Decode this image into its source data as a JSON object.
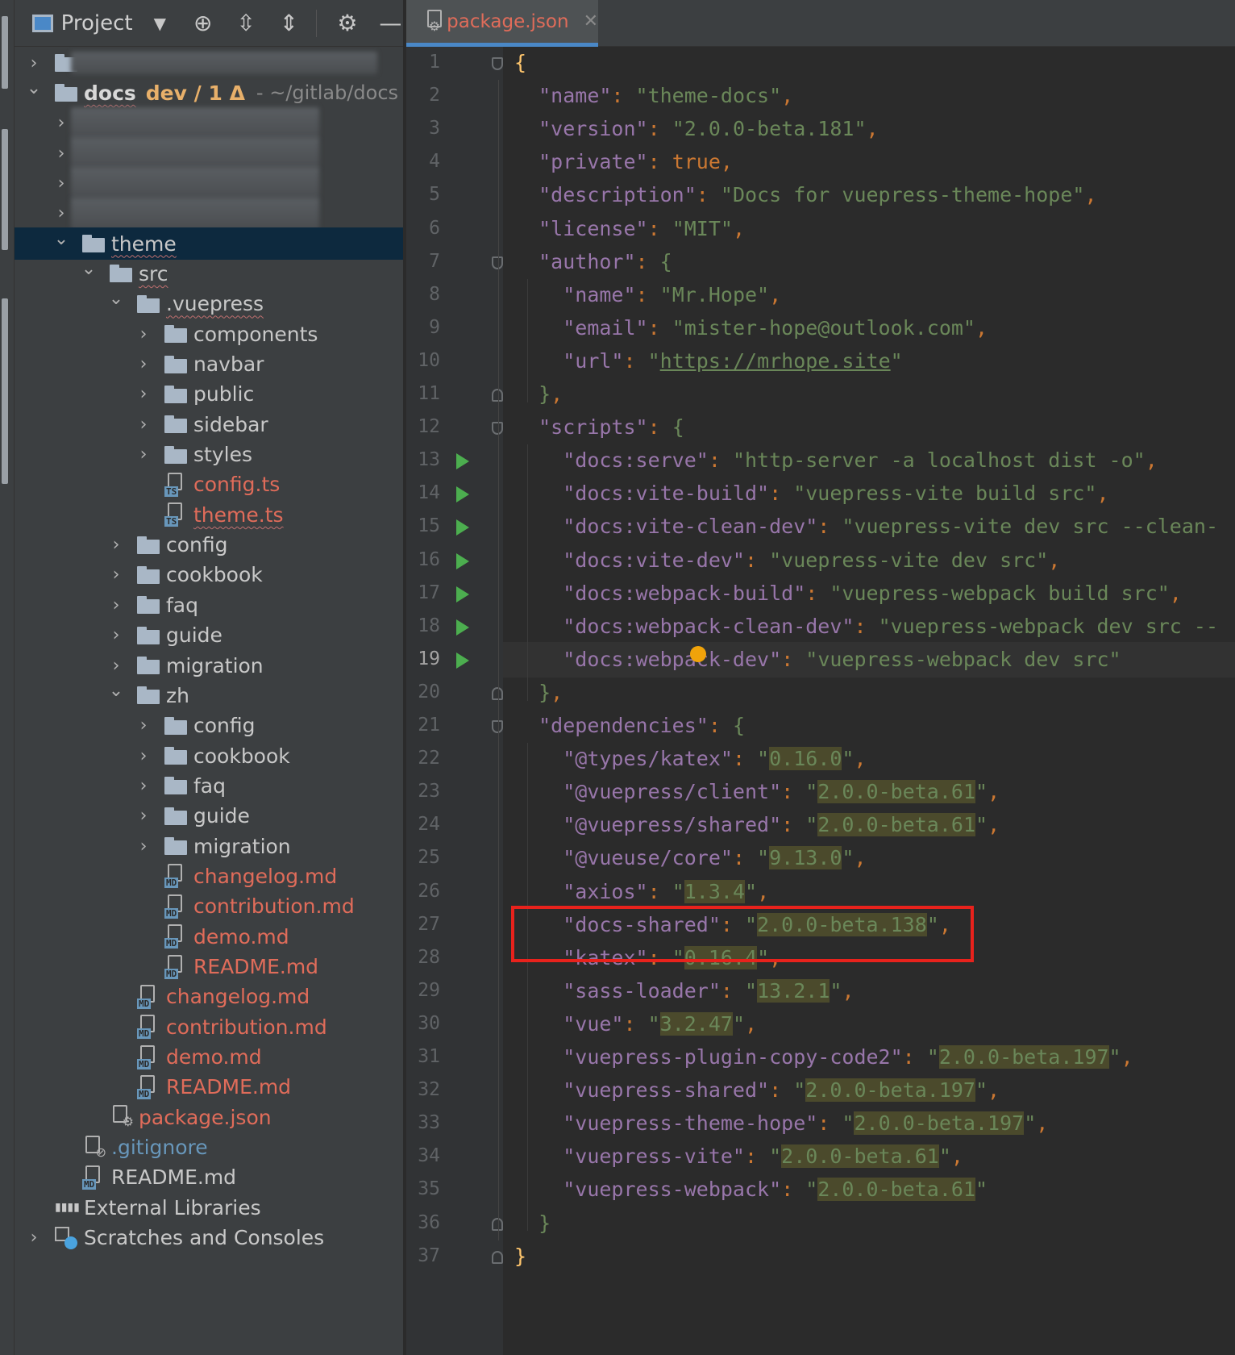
{
  "project_panel": {
    "title": "Project",
    "toolbar_icons": [
      "locate-icon",
      "expand-all-icon",
      "collapse-all-icon",
      "gear-icon",
      "hide-icon"
    ]
  },
  "tree": [
    {
      "depth": 0,
      "arrow": "right",
      "icon": "folder",
      "label": "",
      "style": "blur"
    },
    {
      "depth": 0,
      "arrow": "down",
      "icon": "folder",
      "label": "docs",
      "branch": "dev / 1 Δ",
      "path": "- ~/gitlab/docs",
      "style": "bold"
    },
    {
      "depth": 1,
      "arrow": "right",
      "icon": "none",
      "label": "",
      "style": "blur"
    },
    {
      "depth": 1,
      "arrow": "right",
      "icon": "none",
      "label": "",
      "style": "blur"
    },
    {
      "depth": 1,
      "arrow": "right",
      "icon": "none",
      "label": "",
      "style": "blur"
    },
    {
      "depth": 1,
      "arrow": "right",
      "icon": "none",
      "label": "",
      "style": "blur"
    },
    {
      "depth": 1,
      "arrow": "down",
      "icon": "folder",
      "label": "theme",
      "style": "squiggle",
      "selected": true
    },
    {
      "depth": 2,
      "arrow": "down",
      "icon": "folder",
      "label": "src",
      "style": "squiggle"
    },
    {
      "depth": 3,
      "arrow": "down",
      "icon": "folder",
      "label": ".vuepress",
      "style": "squiggle"
    },
    {
      "depth": 4,
      "arrow": "right",
      "icon": "folder",
      "label": "components"
    },
    {
      "depth": 4,
      "arrow": "right",
      "icon": "folder",
      "label": "navbar"
    },
    {
      "depth": 4,
      "arrow": "right",
      "icon": "folder",
      "label": "public"
    },
    {
      "depth": 4,
      "arrow": "right",
      "icon": "folder",
      "label": "sidebar"
    },
    {
      "depth": 4,
      "arrow": "right",
      "icon": "folder",
      "label": "styles"
    },
    {
      "depth": 4,
      "arrow": "none",
      "icon": "ts",
      "label": "config.ts",
      "style": "red"
    },
    {
      "depth": 4,
      "arrow": "none",
      "icon": "ts",
      "label": "theme.ts",
      "style": "red-squiggle"
    },
    {
      "depth": 3,
      "arrow": "right",
      "icon": "folder",
      "label": "config"
    },
    {
      "depth": 3,
      "arrow": "right",
      "icon": "folder",
      "label": "cookbook"
    },
    {
      "depth": 3,
      "arrow": "right",
      "icon": "folder",
      "label": "faq"
    },
    {
      "depth": 3,
      "arrow": "right",
      "icon": "folder",
      "label": "guide"
    },
    {
      "depth": 3,
      "arrow": "right",
      "icon": "folder",
      "label": "migration"
    },
    {
      "depth": 3,
      "arrow": "down",
      "icon": "folder",
      "label": "zh"
    },
    {
      "depth": 4,
      "arrow": "right",
      "icon": "folder",
      "label": "config"
    },
    {
      "depth": 4,
      "arrow": "right",
      "icon": "folder",
      "label": "cookbook"
    },
    {
      "depth": 4,
      "arrow": "right",
      "icon": "folder",
      "label": "faq"
    },
    {
      "depth": 4,
      "arrow": "right",
      "icon": "folder",
      "label": "guide"
    },
    {
      "depth": 4,
      "arrow": "right",
      "icon": "folder",
      "label": "migration"
    },
    {
      "depth": 4,
      "arrow": "none",
      "icon": "md",
      "label": "changelog.md",
      "style": "red"
    },
    {
      "depth": 4,
      "arrow": "none",
      "icon": "md",
      "label": "contribution.md",
      "style": "red"
    },
    {
      "depth": 4,
      "arrow": "none",
      "icon": "md",
      "label": "demo.md",
      "style": "red"
    },
    {
      "depth": 4,
      "arrow": "none",
      "icon": "md",
      "label": "README.md",
      "style": "red"
    },
    {
      "depth": 3,
      "arrow": "none",
      "icon": "md",
      "label": "changelog.md",
      "style": "red"
    },
    {
      "depth": 3,
      "arrow": "none",
      "icon": "md",
      "label": "contribution.md",
      "style": "red"
    },
    {
      "depth": 3,
      "arrow": "none",
      "icon": "md",
      "label": "demo.md",
      "style": "red"
    },
    {
      "depth": 3,
      "arrow": "none",
      "icon": "md",
      "label": "README.md",
      "style": "red"
    },
    {
      "depth": 2,
      "arrow": "none",
      "icon": "json",
      "label": "package.json",
      "style": "red"
    },
    {
      "depth": 1,
      "arrow": "none",
      "icon": "git",
      "label": ".gitignore",
      "style": "blue"
    },
    {
      "depth": 1,
      "arrow": "none",
      "icon": "md",
      "label": "README.md"
    },
    {
      "depth": 0,
      "arrow": "none",
      "icon": "lib",
      "label": "External Libraries"
    },
    {
      "depth": 0,
      "arrow": "right",
      "icon": "scratch",
      "label": "Scratches and Consoles"
    }
  ],
  "editor": {
    "tab_label": "package.json",
    "current_line": 19,
    "run_lines": [
      13,
      14,
      15,
      16,
      17,
      18,
      19
    ],
    "fold_open_lines": [
      1,
      7,
      12,
      21
    ],
    "fold_close_lines": [
      11,
      20,
      36,
      37
    ],
    "highlight_line": 27,
    "lines": [
      [
        {
          "t": "{",
          "c": "b"
        }
      ],
      [
        {
          "t": "  "
        },
        {
          "t": "\"name\"",
          "c": "k"
        },
        {
          "t": ": ",
          "c": "p"
        },
        {
          "t": "\"theme-docs\"",
          "c": "s"
        },
        {
          "t": ",",
          "c": "p"
        }
      ],
      [
        {
          "t": "  "
        },
        {
          "t": "\"version\"",
          "c": "k"
        },
        {
          "t": ": ",
          "c": "p"
        },
        {
          "t": "\"2.0.0-beta.181\"",
          "c": "s"
        },
        {
          "t": ",",
          "c": "p"
        }
      ],
      [
        {
          "t": "  "
        },
        {
          "t": "\"private\"",
          "c": "k"
        },
        {
          "t": ": ",
          "c": "p"
        },
        {
          "t": "true",
          "c": "kw"
        },
        {
          "t": ",",
          "c": "p"
        }
      ],
      [
        {
          "t": "  "
        },
        {
          "t": "\"description\"",
          "c": "k"
        },
        {
          "t": ": ",
          "c": "p"
        },
        {
          "t": "\"Docs for vuepress-theme-hope\"",
          "c": "s"
        },
        {
          "t": ",",
          "c": "p"
        }
      ],
      [
        {
          "t": "  "
        },
        {
          "t": "\"license\"",
          "c": "k"
        },
        {
          "t": ": ",
          "c": "p"
        },
        {
          "t": "\"MIT\"",
          "c": "s"
        },
        {
          "t": ",",
          "c": "p"
        }
      ],
      [
        {
          "t": "  "
        },
        {
          "t": "\"author\"",
          "c": "k"
        },
        {
          "t": ": ",
          "c": "p"
        },
        {
          "t": "{",
          "c": "bg"
        }
      ],
      [
        {
          "t": "    "
        },
        {
          "t": "\"name\"",
          "c": "k"
        },
        {
          "t": ": ",
          "c": "p"
        },
        {
          "t": "\"Mr.Hope\"",
          "c": "s"
        },
        {
          "t": ",",
          "c": "p"
        }
      ],
      [
        {
          "t": "    "
        },
        {
          "t": "\"email\"",
          "c": "k"
        },
        {
          "t": ": ",
          "c": "p"
        },
        {
          "t": "\"mister-hope@outlook.com\"",
          "c": "s"
        },
        {
          "t": ",",
          "c": "p"
        }
      ],
      [
        {
          "t": "    "
        },
        {
          "t": "\"url\"",
          "c": "k"
        },
        {
          "t": ": ",
          "c": "p"
        },
        {
          "t": "\"",
          "c": "s"
        },
        {
          "t": "https://mrhope.site",
          "c": "url"
        },
        {
          "t": "\"",
          "c": "s"
        }
      ],
      [
        {
          "t": "  "
        },
        {
          "t": "}",
          "c": "bg"
        },
        {
          "t": ",",
          "c": "p"
        }
      ],
      [
        {
          "t": "  "
        },
        {
          "t": "\"scripts\"",
          "c": "k"
        },
        {
          "t": ": ",
          "c": "p"
        },
        {
          "t": "{",
          "c": "bg"
        }
      ],
      [
        {
          "t": "    "
        },
        {
          "t": "\"docs:serve\"",
          "c": "k"
        },
        {
          "t": ": ",
          "c": "p"
        },
        {
          "t": "\"http-server -a localhost dist -o\"",
          "c": "s"
        },
        {
          "t": ",",
          "c": "p"
        }
      ],
      [
        {
          "t": "    "
        },
        {
          "t": "\"docs:vite-build\"",
          "c": "k"
        },
        {
          "t": ": ",
          "c": "p"
        },
        {
          "t": "\"vuepress-vite build src\"",
          "c": "s"
        },
        {
          "t": ",",
          "c": "p"
        }
      ],
      [
        {
          "t": "    "
        },
        {
          "t": "\"docs:vite-clean-dev\"",
          "c": "k"
        },
        {
          "t": ": ",
          "c": "p"
        },
        {
          "t": "\"vuepress-vite dev src --clean-",
          "c": "s"
        }
      ],
      [
        {
          "t": "    "
        },
        {
          "t": "\"docs:vite-dev\"",
          "c": "k"
        },
        {
          "t": ": ",
          "c": "p"
        },
        {
          "t": "\"vuepress-vite dev src\"",
          "c": "s"
        },
        {
          "t": ",",
          "c": "p"
        }
      ],
      [
        {
          "t": "    "
        },
        {
          "t": "\"docs:webpack-build\"",
          "c": "k"
        },
        {
          "t": ": ",
          "c": "p"
        },
        {
          "t": "\"vuepress-webpack build src\"",
          "c": "s"
        },
        {
          "t": ",",
          "c": "p"
        }
      ],
      [
        {
          "t": "    "
        },
        {
          "t": "\"docs:webpack-clean-dev\"",
          "c": "k"
        },
        {
          "t": ": ",
          "c": "p"
        },
        {
          "t": "\"vuepress-webpack dev src --",
          "c": "s"
        }
      ],
      [
        {
          "t": "    "
        },
        {
          "t": "\"docs:webpack-dev\"",
          "c": "k"
        },
        {
          "t": ": ",
          "c": "p"
        },
        {
          "t": "\"vuepress-webpack dev src\"",
          "c": "s"
        }
      ],
      [
        {
          "t": "  "
        },
        {
          "t": "}",
          "c": "bg"
        },
        {
          "t": ",",
          "c": "p"
        }
      ],
      [
        {
          "t": "  "
        },
        {
          "t": "\"dependencies\"",
          "c": "k"
        },
        {
          "t": ": ",
          "c": "p"
        },
        {
          "t": "{",
          "c": "bg"
        }
      ],
      [
        {
          "t": "    "
        },
        {
          "t": "\"@types/katex\"",
          "c": "k"
        },
        {
          "t": ": ",
          "c": "p"
        },
        {
          "t": "\"",
          "c": "s"
        },
        {
          "t": "0.16.0",
          "c": "hl"
        },
        {
          "t": "\"",
          "c": "s"
        },
        {
          "t": ",",
          "c": "p"
        }
      ],
      [
        {
          "t": "    "
        },
        {
          "t": "\"@vuepress/client\"",
          "c": "k"
        },
        {
          "t": ": ",
          "c": "p"
        },
        {
          "t": "\"",
          "c": "s"
        },
        {
          "t": "2.0.0-beta.61",
          "c": "hl"
        },
        {
          "t": "\"",
          "c": "s"
        },
        {
          "t": ",",
          "c": "p"
        }
      ],
      [
        {
          "t": "    "
        },
        {
          "t": "\"@vuepress/shared\"",
          "c": "k"
        },
        {
          "t": ": ",
          "c": "p"
        },
        {
          "t": "\"",
          "c": "s"
        },
        {
          "t": "2.0.0-beta.61",
          "c": "hl"
        },
        {
          "t": "\"",
          "c": "s"
        },
        {
          "t": ",",
          "c": "p"
        }
      ],
      [
        {
          "t": "    "
        },
        {
          "t": "\"@vueuse/core\"",
          "c": "k"
        },
        {
          "t": ": ",
          "c": "p"
        },
        {
          "t": "\"",
          "c": "s"
        },
        {
          "t": "9.13.0",
          "c": "hl"
        },
        {
          "t": "\"",
          "c": "s"
        },
        {
          "t": ",",
          "c": "p"
        }
      ],
      [
        {
          "t": "    "
        },
        {
          "t": "\"axios\"",
          "c": "k"
        },
        {
          "t": ": ",
          "c": "p"
        },
        {
          "t": "\"",
          "c": "s"
        },
        {
          "t": "1.3.4",
          "c": "hl"
        },
        {
          "t": "\"",
          "c": "s"
        },
        {
          "t": ",",
          "c": "p"
        }
      ],
      [
        {
          "t": "    "
        },
        {
          "t": "\"docs-shared\"",
          "c": "k"
        },
        {
          "t": ": ",
          "c": "p"
        },
        {
          "t": "\"",
          "c": "s"
        },
        {
          "t": "2.0.0-beta.138",
          "c": "hl"
        },
        {
          "t": "\"",
          "c": "s"
        },
        {
          "t": ",",
          "c": "p"
        }
      ],
      [
        {
          "t": "    "
        },
        {
          "t": "\"katex\"",
          "c": "k"
        },
        {
          "t": ": ",
          "c": "p"
        },
        {
          "t": "\"",
          "c": "s"
        },
        {
          "t": "0.16.4",
          "c": "hl"
        },
        {
          "t": "\"",
          "c": "s"
        },
        {
          "t": ",",
          "c": "p"
        }
      ],
      [
        {
          "t": "    "
        },
        {
          "t": "\"sass-loader\"",
          "c": "k"
        },
        {
          "t": ": ",
          "c": "p"
        },
        {
          "t": "\"",
          "c": "s"
        },
        {
          "t": "13.2.1",
          "c": "hl"
        },
        {
          "t": "\"",
          "c": "s"
        },
        {
          "t": ",",
          "c": "p"
        }
      ],
      [
        {
          "t": "    "
        },
        {
          "t": "\"vue\"",
          "c": "k"
        },
        {
          "t": ": ",
          "c": "p"
        },
        {
          "t": "\"",
          "c": "s"
        },
        {
          "t": "3.2.47",
          "c": "hl"
        },
        {
          "t": "\"",
          "c": "s"
        },
        {
          "t": ",",
          "c": "p"
        }
      ],
      [
        {
          "t": "    "
        },
        {
          "t": "\"vuepress-plugin-copy-code2\"",
          "c": "k"
        },
        {
          "t": ": ",
          "c": "p"
        },
        {
          "t": "\"",
          "c": "s"
        },
        {
          "t": "2.0.0-beta.197",
          "c": "hl"
        },
        {
          "t": "\"",
          "c": "s"
        },
        {
          "t": ",",
          "c": "p"
        }
      ],
      [
        {
          "t": "    "
        },
        {
          "t": "\"vuepress-shared\"",
          "c": "k"
        },
        {
          "t": ": ",
          "c": "p"
        },
        {
          "t": "\"",
          "c": "s"
        },
        {
          "t": "2.0.0-beta.197",
          "c": "hl"
        },
        {
          "t": "\"",
          "c": "s"
        },
        {
          "t": ",",
          "c": "p"
        }
      ],
      [
        {
          "t": "    "
        },
        {
          "t": "\"vuepress-theme-hope\"",
          "c": "k"
        },
        {
          "t": ": ",
          "c": "p"
        },
        {
          "t": "\"",
          "c": "s"
        },
        {
          "t": "2.0.0-beta.197",
          "c": "hl"
        },
        {
          "t": "\"",
          "c": "s"
        },
        {
          "t": ",",
          "c": "p"
        }
      ],
      [
        {
          "t": "    "
        },
        {
          "t": "\"vuepress-vite\"",
          "c": "k"
        },
        {
          "t": ": ",
          "c": "p"
        },
        {
          "t": "\"",
          "c": "s"
        },
        {
          "t": "2.0.0-beta.61",
          "c": "hl"
        },
        {
          "t": "\"",
          "c": "s"
        },
        {
          "t": ",",
          "c": "p"
        }
      ],
      [
        {
          "t": "    "
        },
        {
          "t": "\"vuepress-webpack\"",
          "c": "k"
        },
        {
          "t": ": ",
          "c": "p"
        },
        {
          "t": "\"",
          "c": "s"
        },
        {
          "t": "2.0.0-beta.61",
          "c": "hl"
        },
        {
          "t": "\"",
          "c": "s"
        }
      ],
      [
        {
          "t": "  "
        },
        {
          "t": "}",
          "c": "bg"
        }
      ],
      [
        {
          "t": "}",
          "c": "b"
        }
      ]
    ]
  },
  "colors": {
    "annotation_box": "#e8221c",
    "run_marker": "#4cae4f",
    "vcs_modified": "#e06c5a"
  }
}
